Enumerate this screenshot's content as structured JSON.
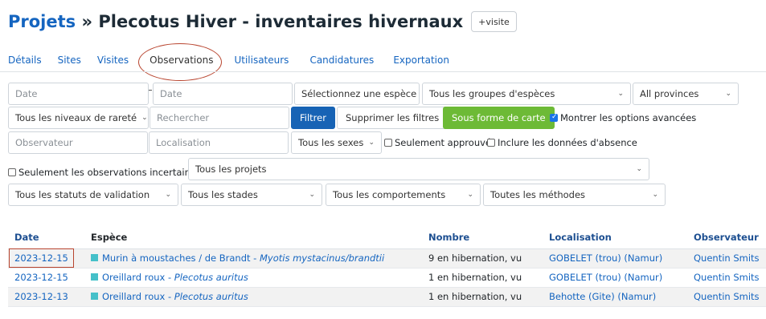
{
  "header": {
    "crumb": "Projets",
    "separator": " » ",
    "title": "Plecotus Hiver - inventaires hivernaux",
    "visit_button": "+visite"
  },
  "tabs": [
    "Détails",
    "Sites",
    "Visites",
    "Observations",
    "Utilisateurs",
    "Candidatures",
    "Exportation"
  ],
  "active_tab": "Observations",
  "filters": {
    "date_from_placeholder": "Date",
    "date_to_placeholder": "Date",
    "species_placeholder": "Sélectionnez une espèce",
    "species_groups": "Tous les groupes d'espèces",
    "provinces": "All provinces",
    "rarity": "Tous les niveaux de rareté",
    "search_placeholder": "Rechercher",
    "filter_button": "Filtrer",
    "clear_button": "Supprimer les filtres",
    "map_button": "Sous forme de carte",
    "advanced_options": "Montrer les options avancées",
    "observer_placeholder": "Observateur",
    "location_placeholder": "Localisation",
    "sexes": "Tous les sexes",
    "only_approved": "Seulement approuvé",
    "include_absence": "Inclure les données d'absence",
    "only_uncertain": "Seulement les observations incertaines",
    "projects": "Tous les projets",
    "validation_status": "Tous les statuts de validation",
    "stages": "Tous les stades",
    "behaviours": "Tous les comportements",
    "methods": "Toutes les méthodes"
  },
  "table": {
    "headers": [
      "Date",
      "Espèce",
      "Nombre",
      "Localisation",
      "Observateur"
    ],
    "rows": [
      {
        "date": "2023-12-15",
        "species": "Murin à moustaches / de Brandt",
        "latin": "Myotis mystacinus/brandtii",
        "number": "9 en hibernation, vu",
        "location": "GOBELET (trou) (Namur)",
        "observer": "Quentin Smits"
      },
      {
        "date": "2023-12-15",
        "species": "Oreillard roux",
        "latin": "Plecotus auritus",
        "number": "1 en hibernation, vu",
        "location": "GOBELET (trou) (Namur)",
        "observer": "Quentin Smits"
      },
      {
        "date": "2023-12-13",
        "species": "Oreillard roux",
        "latin": "Plecotus auritus",
        "number": "1 en hibernation, vu",
        "location": "Behotte (Gite) (Namur)",
        "observer": "Quentin Smits"
      }
    ]
  },
  "colors": {
    "accent": "#1565c0",
    "species_square": "#45c0c9",
    "map_button": "#6dba36",
    "filter_button": "#1763b5"
  }
}
